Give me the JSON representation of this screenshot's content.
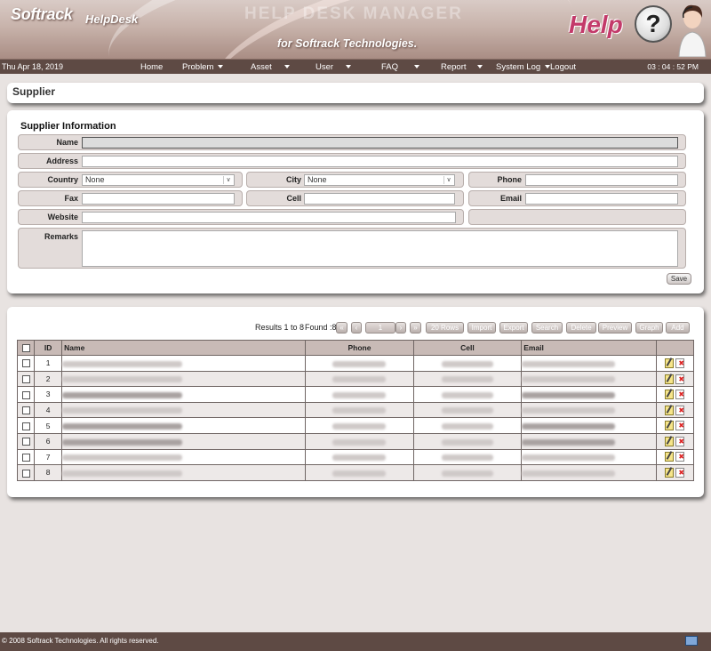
{
  "banner": {
    "brand": "Softrack",
    "product": "HelpDesk",
    "watermark": "Help Desk Manager",
    "tagline": "for Softrack Technologies.",
    "help_word": "Help",
    "question_mark": "?"
  },
  "navbar": {
    "date": "Thu Apr 18, 2019",
    "clock": "03 : 04 : 52 PM",
    "items": [
      {
        "label": "Home",
        "dropdown": false
      },
      {
        "label": "Problem",
        "dropdown": true
      },
      {
        "label": "Asset",
        "dropdown": true
      },
      {
        "label": "User",
        "dropdown": true
      },
      {
        "label": "FAQ",
        "dropdown": true
      },
      {
        "label": "Report",
        "dropdown": true
      },
      {
        "label": "System Log",
        "dropdown": true
      },
      {
        "label": "Logout",
        "dropdown": false
      }
    ]
  },
  "page": {
    "title": "Supplier"
  },
  "form": {
    "section_title": "Supplier Information",
    "name_label": "Name",
    "name_value": "",
    "address_label": "Address",
    "address_value": "",
    "country_label": "Country",
    "country_value": "None",
    "city_label": "City",
    "city_value": "None",
    "phone_label": "Phone",
    "phone_value": "",
    "fax_label": "Fax",
    "fax_value": "",
    "cell_label": "Cell",
    "cell_value": "",
    "email_label": "Email",
    "email_value": "",
    "website_label": "Website",
    "website_value": "",
    "remarks_label": "Remarks",
    "remarks_value": "",
    "save_label": "Save"
  },
  "list": {
    "results_text": "Results 1 to 8",
    "found_text": "Found :8",
    "page_value": "1",
    "rows_button": "20 Rows",
    "buttons": [
      "Import",
      "Export",
      "Search",
      "Delete",
      "Preview",
      "Graph",
      "Add"
    ],
    "columns": {
      "id": "ID",
      "name": "Name",
      "phone": "Phone",
      "cell": "Cell",
      "email": "Email"
    },
    "rows": [
      {
        "id": "1"
      },
      {
        "id": "2"
      },
      {
        "id": "3"
      },
      {
        "id": "4"
      },
      {
        "id": "5"
      },
      {
        "id": "6"
      },
      {
        "id": "7"
      },
      {
        "id": "8"
      }
    ]
  },
  "footer": {
    "copyright": "© 2008  Softrack Technologies. All rights reserved."
  },
  "colors": {
    "nav": "#5e4a44",
    "header_cell": "#c8bab6",
    "field_bg": "#e3dcda"
  }
}
